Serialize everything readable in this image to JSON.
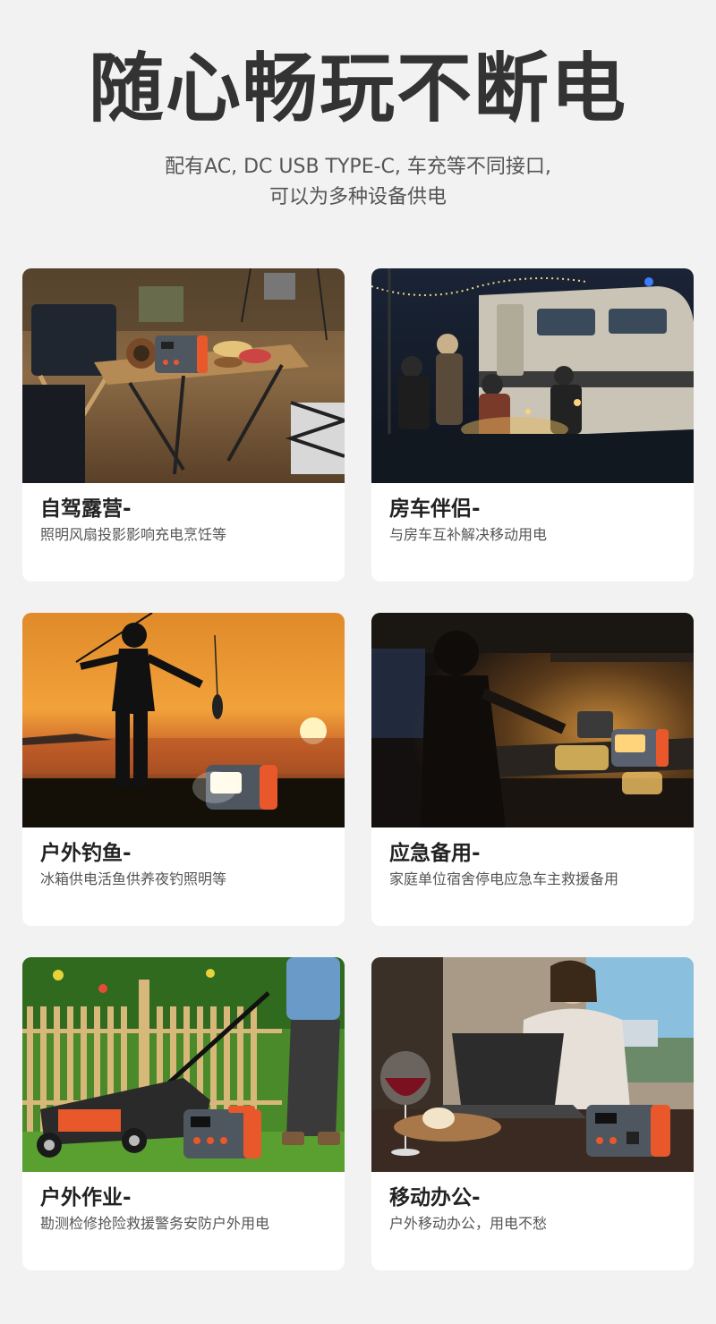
{
  "hero": {
    "headline": "随心畅玩不断电",
    "subtitle_line1": "配有AC, DC USB TYPE-C, 车充等不同接口,",
    "subtitle_line2": "可以为多种设备供电"
  },
  "cards": [
    {
      "title": "自驾露营-",
      "desc": "照明风扇投影影响充电烹饪等"
    },
    {
      "title": "房车伴侣-",
      "desc": "与房车互补解决移动用电"
    },
    {
      "title": "户外钓鱼-",
      "desc": "冰箱供电活鱼供养夜钓照明等"
    },
    {
      "title": "应急备用-",
      "desc": "家庭单位宿舍停电应急车主救援备用"
    },
    {
      "title": "户外作业-",
      "desc": "勘测检修抢险救援警务安防户外用电"
    },
    {
      "title": "移动办公-",
      "desc": "户外移动办公，用电不愁"
    }
  ],
  "colors": {
    "background": "#f2f2f2",
    "card": "#ffffff",
    "text_dark": "#333333",
    "text_muted": "#555555",
    "product_accent": "#e8582a",
    "product_body": "#4e5660"
  }
}
